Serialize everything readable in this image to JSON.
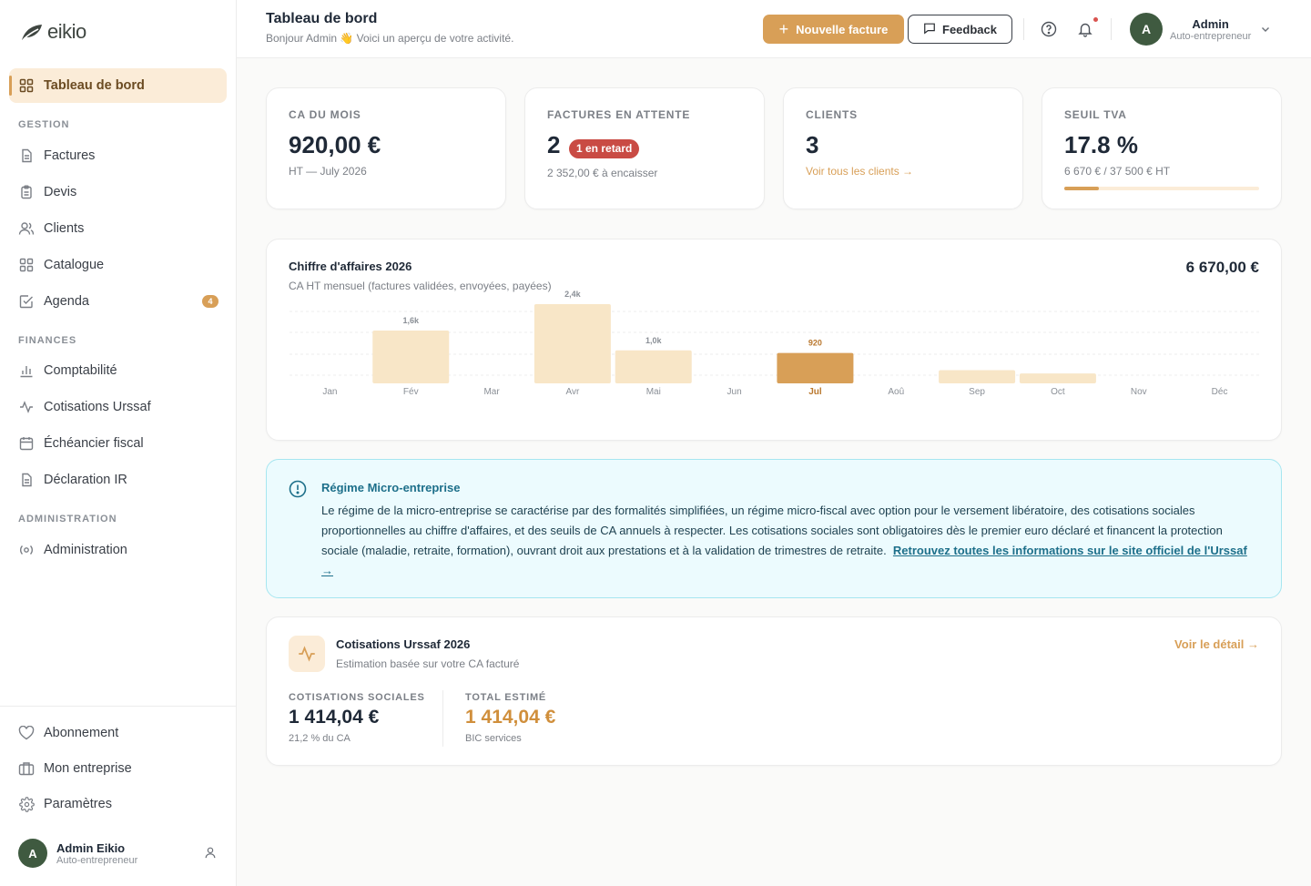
{
  "brand": {
    "name": "eikio"
  },
  "sidebar": {
    "active": {
      "label": "Tableau de bord",
      "icon": "dashboard-icon"
    },
    "sections": [
      {
        "label": "GESTION",
        "items": [
          {
            "label": "Factures",
            "icon": "file-icon"
          },
          {
            "label": "Devis",
            "icon": "clipboard-icon"
          },
          {
            "label": "Clients",
            "icon": "users-icon"
          },
          {
            "label": "Catalogue",
            "icon": "grid-icon"
          },
          {
            "label": "Agenda",
            "icon": "checkbox-icon",
            "badge": "4"
          }
        ]
      },
      {
        "label": "FINANCES",
        "items": [
          {
            "label": "Comptabilité",
            "icon": "bar-chart-icon"
          },
          {
            "label": "Cotisations Urssaf",
            "icon": "activity-icon"
          },
          {
            "label": "Échéancier fiscal",
            "icon": "calendar-icon"
          },
          {
            "label": "Déclaration IR",
            "icon": "file-icon"
          }
        ]
      },
      {
        "label": "ADMINISTRATION",
        "items": [
          {
            "label": "Administration",
            "icon": "radio-icon"
          }
        ]
      }
    ],
    "bottom": [
      {
        "label": "Abonnement",
        "icon": "heart-icon"
      },
      {
        "label": "Mon entreprise",
        "icon": "briefcase-icon"
      },
      {
        "label": "Paramètres",
        "icon": "gear-icon"
      }
    ],
    "user": {
      "initial": "A",
      "name": "Admin Eikio",
      "role": "Auto-entrepreneur"
    }
  },
  "header": {
    "title": "Tableau de bord",
    "subtitle": "Bonjour Admin 👋 Voici un aperçu de votre activité.",
    "new_invoice": "Nouvelle facture",
    "feedback": "Feedback",
    "user": {
      "initial": "A",
      "name": "Admin",
      "role": "Auto-entrepreneur"
    }
  },
  "kpis": {
    "ca": {
      "label": "CA DU MOIS",
      "value": "920,00 €",
      "sub": "HT — July 2026"
    },
    "pending": {
      "label": "FACTURES EN ATTENTE",
      "value": "2",
      "badge": "1 en retard",
      "sub": "2 352,00 € à encaisser"
    },
    "clients": {
      "label": "CLIENTS",
      "value": "3",
      "link": "Voir tous les clients →"
    },
    "tva": {
      "label": "SEUIL TVA",
      "value": "17.8 %",
      "sub": "6 670 € / 37 500 € HT",
      "progress": 0.178
    }
  },
  "chart": {
    "title": "Chiffre d'affaires 2026",
    "subtitle": "CA HT mensuel (factures validées, envoyées, payées)",
    "total": "6 670,00 €"
  },
  "chart_data": {
    "type": "bar",
    "categories": [
      "Jan",
      "Fév",
      "Mar",
      "Avr",
      "Mai",
      "Jun",
      "Jul",
      "Aoû",
      "Sep",
      "Oct",
      "Nov",
      "Déc"
    ],
    "values": [
      0,
      1600,
      0,
      2400,
      1000,
      0,
      920,
      0,
      400,
      300,
      0,
      0
    ],
    "data_labels": [
      "",
      "1,6k",
      "",
      "2,4k",
      "1,0k",
      "",
      "920",
      "",
      "",
      "",
      "",
      ""
    ],
    "highlight_index": 6,
    "ylim": [
      0,
      2400
    ],
    "grid": true,
    "colors": {
      "bar": "#f8e6c7",
      "highlight": "#d89f57"
    }
  },
  "info": {
    "title": "Régime Micro-entreprise",
    "body": "Le régime de la micro-entreprise se caractérise par des formalités simplifiées, un régime micro-fiscal avec option pour le versement libératoire, des cotisations sociales proportionnelles au chiffre d'affaires, et des seuils de CA annuels à respecter. Les cotisations sociales sont obligatoires dès le premier euro déclaré et financent la protection sociale (maladie, retraite, formation), ouvrant droit aux prestations et à la validation de trimestres de retraite.",
    "link": "Retrouvez toutes les informations sur le site officiel de l'Urssaf →"
  },
  "urssaf": {
    "title": "Cotisations Urssaf 2026",
    "subtitle": "Estimation basée sur votre CA facturé",
    "link": "Voir le détail →",
    "cotisations": {
      "label": "COTISATIONS SOCIALES",
      "value": "1 414,04 €",
      "sub": "21,2 % du CA"
    },
    "total": {
      "label": "TOTAL ESTIMÉ",
      "value": "1 414,04 €",
      "sub": "BIC services"
    }
  },
  "colors": {
    "accent": "#d89f57",
    "accent_light": "#fbecd8",
    "danger": "#c94b44",
    "info": "#1d6f8a",
    "avatar": "#3f5a40"
  }
}
